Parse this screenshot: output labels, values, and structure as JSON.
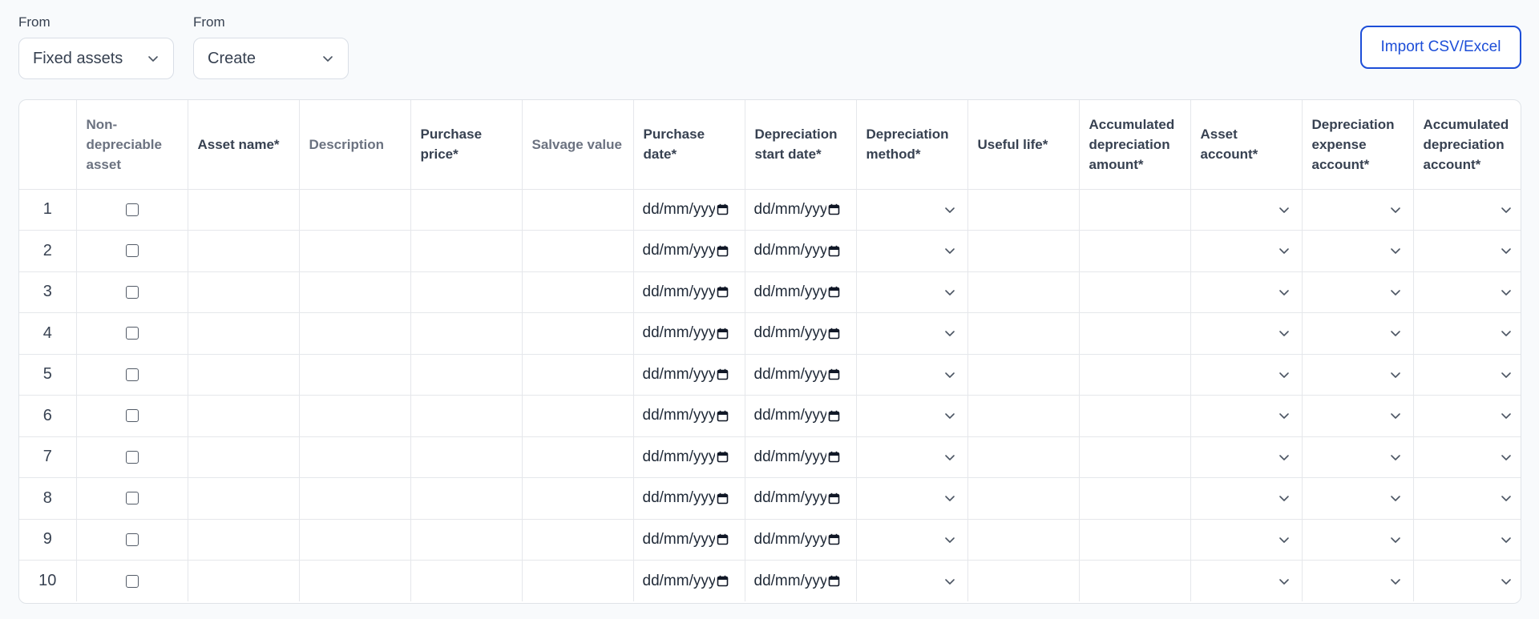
{
  "filters": [
    {
      "label": "From",
      "value": "Fixed assets"
    },
    {
      "label": "From",
      "value": "Create"
    }
  ],
  "import_button": {
    "label": "Import CSV/Excel"
  },
  "table": {
    "headers": [
      {
        "label": "",
        "muted": false
      },
      {
        "label": "Non-depreciable asset",
        "muted": true
      },
      {
        "label": "Asset name*",
        "muted": false
      },
      {
        "label": "Description",
        "muted": true
      },
      {
        "label": "Purchase price*",
        "muted": false
      },
      {
        "label": "Salvage value",
        "muted": true
      },
      {
        "label": "Purchase date*",
        "muted": false
      },
      {
        "label": "Depreciation start date*",
        "muted": false
      },
      {
        "label": "Depreciation method*",
        "muted": false
      },
      {
        "label": "Useful life*",
        "muted": false
      },
      {
        "label": "Accumulated depreciation amount*",
        "muted": false
      },
      {
        "label": "Asset account*",
        "muted": false
      },
      {
        "label": "Depreciation expense account*",
        "muted": false
      },
      {
        "label": "Accumulated depreciation account*",
        "muted": false
      }
    ],
    "date_placeholder": "dd/mm/yyyy",
    "rows": [
      "1",
      "2",
      "3",
      "4",
      "5",
      "6",
      "7",
      "8",
      "9",
      "10"
    ]
  },
  "icons": {
    "dropdown": "chevron-down-icon",
    "calendar": "calendar-icon"
  },
  "colors": {
    "background": "#f8fafc",
    "accent": "#1d4ed8",
    "border": "#e5e7eb"
  }
}
